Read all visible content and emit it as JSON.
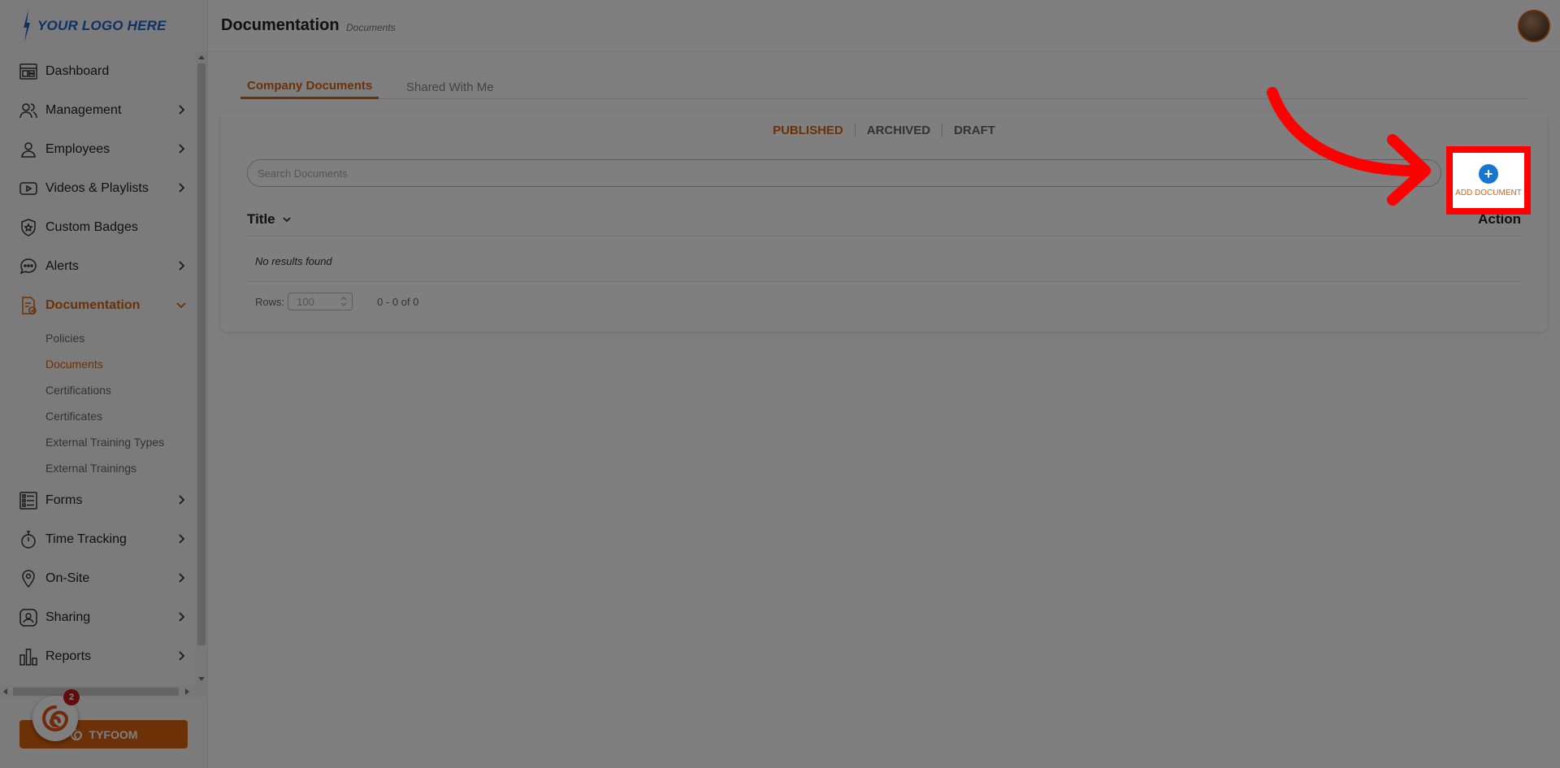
{
  "logo": {
    "text": "YOUR LOGO HERE"
  },
  "sidebar": {
    "items": [
      {
        "label": "Dashboard",
        "icon": "dashboard-icon",
        "chevron": false
      },
      {
        "label": "Management",
        "icon": "management-icon",
        "chevron": true
      },
      {
        "label": "Employees",
        "icon": "employee-icon",
        "chevron": true
      },
      {
        "label": "Videos & Playlists",
        "icon": "video-icon",
        "chevron": true
      },
      {
        "label": "Custom Badges",
        "icon": "badge-icon",
        "chevron": false
      },
      {
        "label": "Alerts",
        "icon": "alert-chat-icon",
        "chevron": true
      },
      {
        "label": "Documentation",
        "icon": "document-check-icon",
        "chevron": true,
        "active": true
      },
      {
        "label": "Forms",
        "icon": "form-list-icon",
        "chevron": true
      },
      {
        "label": "Time Tracking",
        "icon": "stopwatch-icon",
        "chevron": true
      },
      {
        "label": "On-Site",
        "icon": "location-pin-icon",
        "chevron": true
      },
      {
        "label": "Sharing",
        "icon": "share-user-icon",
        "chevron": true
      },
      {
        "label": "Reports",
        "icon": "bar-chart-icon",
        "chevron": true
      }
    ],
    "subitems": [
      {
        "label": "Policies"
      },
      {
        "label": "Documents",
        "active": true
      },
      {
        "label": "Certifications"
      },
      {
        "label": "Certificates"
      },
      {
        "label": "External Training Types"
      },
      {
        "label": "External Trainings"
      }
    ],
    "brand_button": "TYFOOM",
    "chat_badge": "2"
  },
  "header": {
    "title": "Documentation",
    "subtitle": "Documents"
  },
  "tabs": [
    {
      "label": "Company Documents",
      "active": true
    },
    {
      "label": "Shared With Me",
      "active": false
    }
  ],
  "status_tabs": [
    {
      "label": "PUBLISHED",
      "active": true
    },
    {
      "label": "ARCHIVED",
      "active": false
    },
    {
      "label": "DRAFT",
      "active": false
    }
  ],
  "search": {
    "placeholder": "Search Documents"
  },
  "add_document": {
    "label": "ADD DOCUMENT",
    "plus": "+"
  },
  "table": {
    "columns": [
      "Title",
      "Action"
    ],
    "empty_message": "No results found"
  },
  "pager": {
    "rows_label": "Rows:",
    "rows_value": "100",
    "range": "0 - 0 of 0"
  },
  "colors": {
    "accent": "#d9620f",
    "primary_blue": "#1677d2",
    "highlight": "#ff0000"
  }
}
